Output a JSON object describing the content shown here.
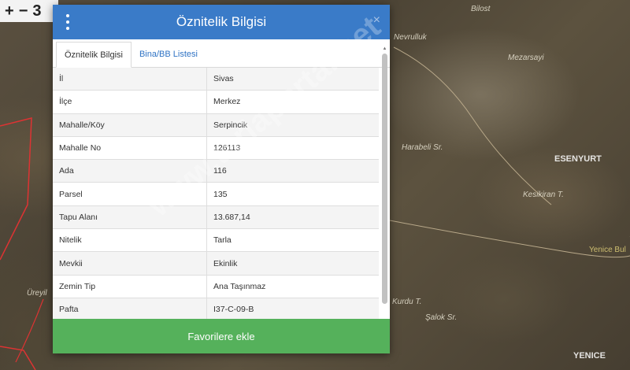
{
  "map": {
    "zoom_in": "+",
    "zoom_out": "−",
    "zoom_extra": "3",
    "labels": {
      "bilost": "Bilost",
      "nevrulluk": "Nevrulluk",
      "mezarsay": "Mezarsayi",
      "harabeli": "Harabeli Sr.",
      "esenyurt": "ESENYURT",
      "kesikiran": "Kesikiran T.",
      "yenice_bul": "Yenice Bul",
      "yenice": "YENICE",
      "ureyil": "Üreyil",
      "saglik": "Şalok Sr.",
      "kurdu": "Kurdu T."
    },
    "watermark": "www.tarlaportal.net"
  },
  "dialog": {
    "title": "Öznitelik Bilgisi",
    "close_label": "×",
    "tabs": [
      {
        "label": "Öznitelik Bilgisi"
      },
      {
        "label": "Bina/BB Listesi"
      }
    ],
    "rows": [
      {
        "key": "İl",
        "value": "Sivas"
      },
      {
        "key": "İlçe",
        "value": "Merkez"
      },
      {
        "key": "Mahalle/Köy",
        "value": "Serpincik"
      },
      {
        "key": "Mahalle No",
        "value": "126113"
      },
      {
        "key": "Ada",
        "value": "116"
      },
      {
        "key": "Parsel",
        "value": "135"
      },
      {
        "key": "Tapu Alanı",
        "value": "13.687,14"
      },
      {
        "key": "Nitelik",
        "value": "Tarla"
      },
      {
        "key": "Mevkii",
        "value": "Ekinlik"
      },
      {
        "key": "Zemin Tip",
        "value": "Ana Taşınmaz"
      },
      {
        "key": "Pafta",
        "value": "I37-C-09-B"
      }
    ],
    "favorite_button": "Favorilere ekle"
  },
  "colors": {
    "header": "#3a7bc8",
    "button": "#55b15b",
    "tab_link": "#2f73c4"
  },
  "icons": {
    "menu": "menu-dots-icon",
    "close": "close-icon",
    "scroll_up": "scroll-up-icon",
    "scroll_down": "scroll-down-icon"
  }
}
